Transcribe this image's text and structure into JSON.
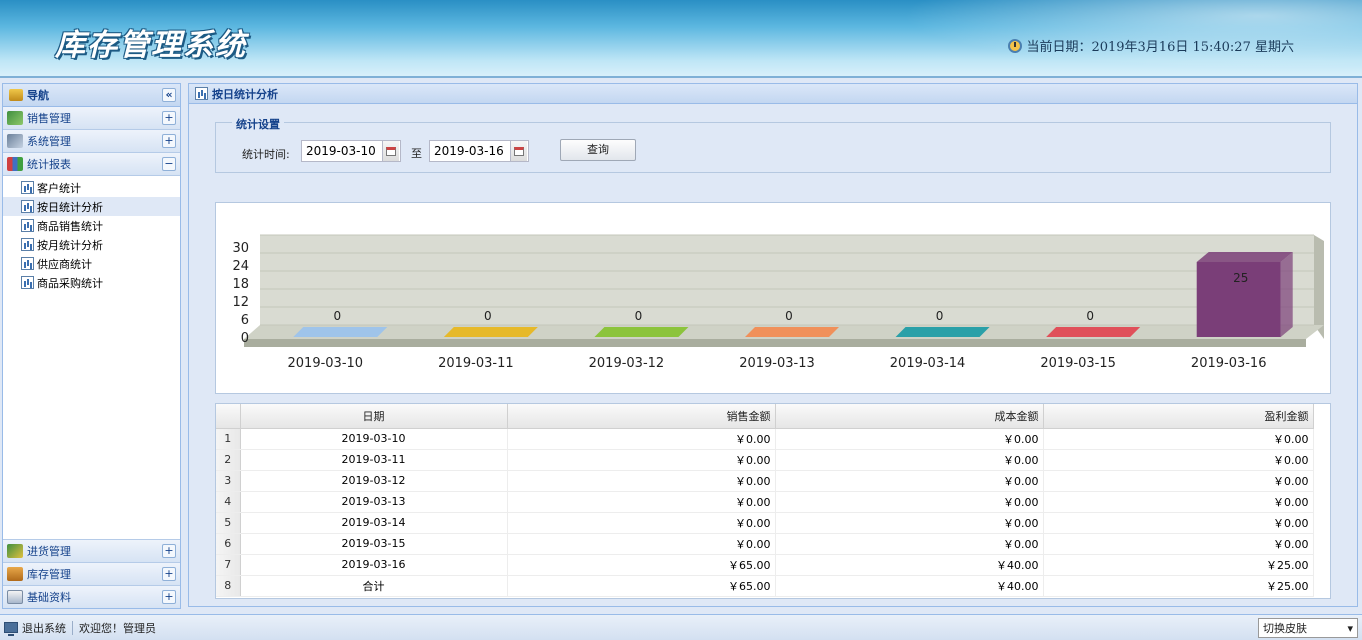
{
  "header": {
    "app_title": "库存管理系统",
    "date_text": "当前日期：2019年3月16日  15:40:27 星期六"
  },
  "sidebar": {
    "title": "导航",
    "collapse_glyph": "«",
    "top_items": [
      {
        "label": "销售管理",
        "icon": "sales-icon",
        "toggle": "+"
      },
      {
        "label": "系统管理",
        "icon": "computer-icon",
        "toggle": "+"
      },
      {
        "label": "统计报表",
        "icon": "chart-icon",
        "toggle": "−"
      }
    ],
    "sub_items": [
      {
        "label": "客户统计",
        "active": false
      },
      {
        "label": "按日统计分析",
        "active": true
      },
      {
        "label": "商品销售统计",
        "active": false
      },
      {
        "label": "按月统计分析",
        "active": false
      },
      {
        "label": "供应商统计",
        "active": false
      },
      {
        "label": "商品采购统计",
        "active": false
      }
    ],
    "bottom_items": [
      {
        "label": "进货管理",
        "icon": "purchase-icon",
        "toggle": "+"
      },
      {
        "label": "库存管理",
        "icon": "folder-icon",
        "toggle": "+"
      },
      {
        "label": "基础资料",
        "icon": "document-icon",
        "toggle": "+"
      }
    ]
  },
  "main": {
    "panel_title": "按日统计分析",
    "settings_legend": "统计设置",
    "time_label": "统计时间:",
    "start_date": "2019-03-10",
    "to_label": "至",
    "end_date": "2019-03-16",
    "query_label": "查询"
  },
  "chart_data": {
    "type": "bar",
    "categories": [
      "2019-03-10",
      "2019-03-11",
      "2019-03-12",
      "2019-03-13",
      "2019-03-14",
      "2019-03-15",
      "2019-03-16"
    ],
    "values": [
      0,
      0,
      0,
      0,
      0,
      0,
      25
    ],
    "bar_colors": [
      "#9fc4ea",
      "#e6b92a",
      "#8cc43c",
      "#f0905a",
      "#2aa0a8",
      "#e0505a",
      "#7a3e78"
    ],
    "yticks": [
      0,
      6,
      12,
      18,
      24,
      30
    ],
    "ylim": [
      0,
      30
    ],
    "grid": true,
    "legend": "none"
  },
  "grid": {
    "columns": [
      "日期",
      "销售金额",
      "成本金额",
      "盈利金额"
    ],
    "rows": [
      {
        "n": "1",
        "date": "2019-03-10",
        "sales": "￥0.00",
        "cost": "￥0.00",
        "profit": "￥0.00"
      },
      {
        "n": "2",
        "date": "2019-03-11",
        "sales": "￥0.00",
        "cost": "￥0.00",
        "profit": "￥0.00"
      },
      {
        "n": "3",
        "date": "2019-03-12",
        "sales": "￥0.00",
        "cost": "￥0.00",
        "profit": "￥0.00"
      },
      {
        "n": "4",
        "date": "2019-03-13",
        "sales": "￥0.00",
        "cost": "￥0.00",
        "profit": "￥0.00"
      },
      {
        "n": "5",
        "date": "2019-03-14",
        "sales": "￥0.00",
        "cost": "￥0.00",
        "profit": "￥0.00"
      },
      {
        "n": "6",
        "date": "2019-03-15",
        "sales": "￥0.00",
        "cost": "￥0.00",
        "profit": "￥0.00"
      },
      {
        "n": "7",
        "date": "2019-03-16",
        "sales": "￥65.00",
        "cost": "￥40.00",
        "profit": "￥25.00"
      },
      {
        "n": "8",
        "date": "合计",
        "sales": "￥65.00",
        "cost": "￥40.00",
        "profit": "￥25.00"
      }
    ]
  },
  "footer": {
    "logout_label": "退出系统",
    "welcome_text": "欢迎您！管理员",
    "skin_label": "切换皮肤",
    "skin_arrow": "▾"
  }
}
